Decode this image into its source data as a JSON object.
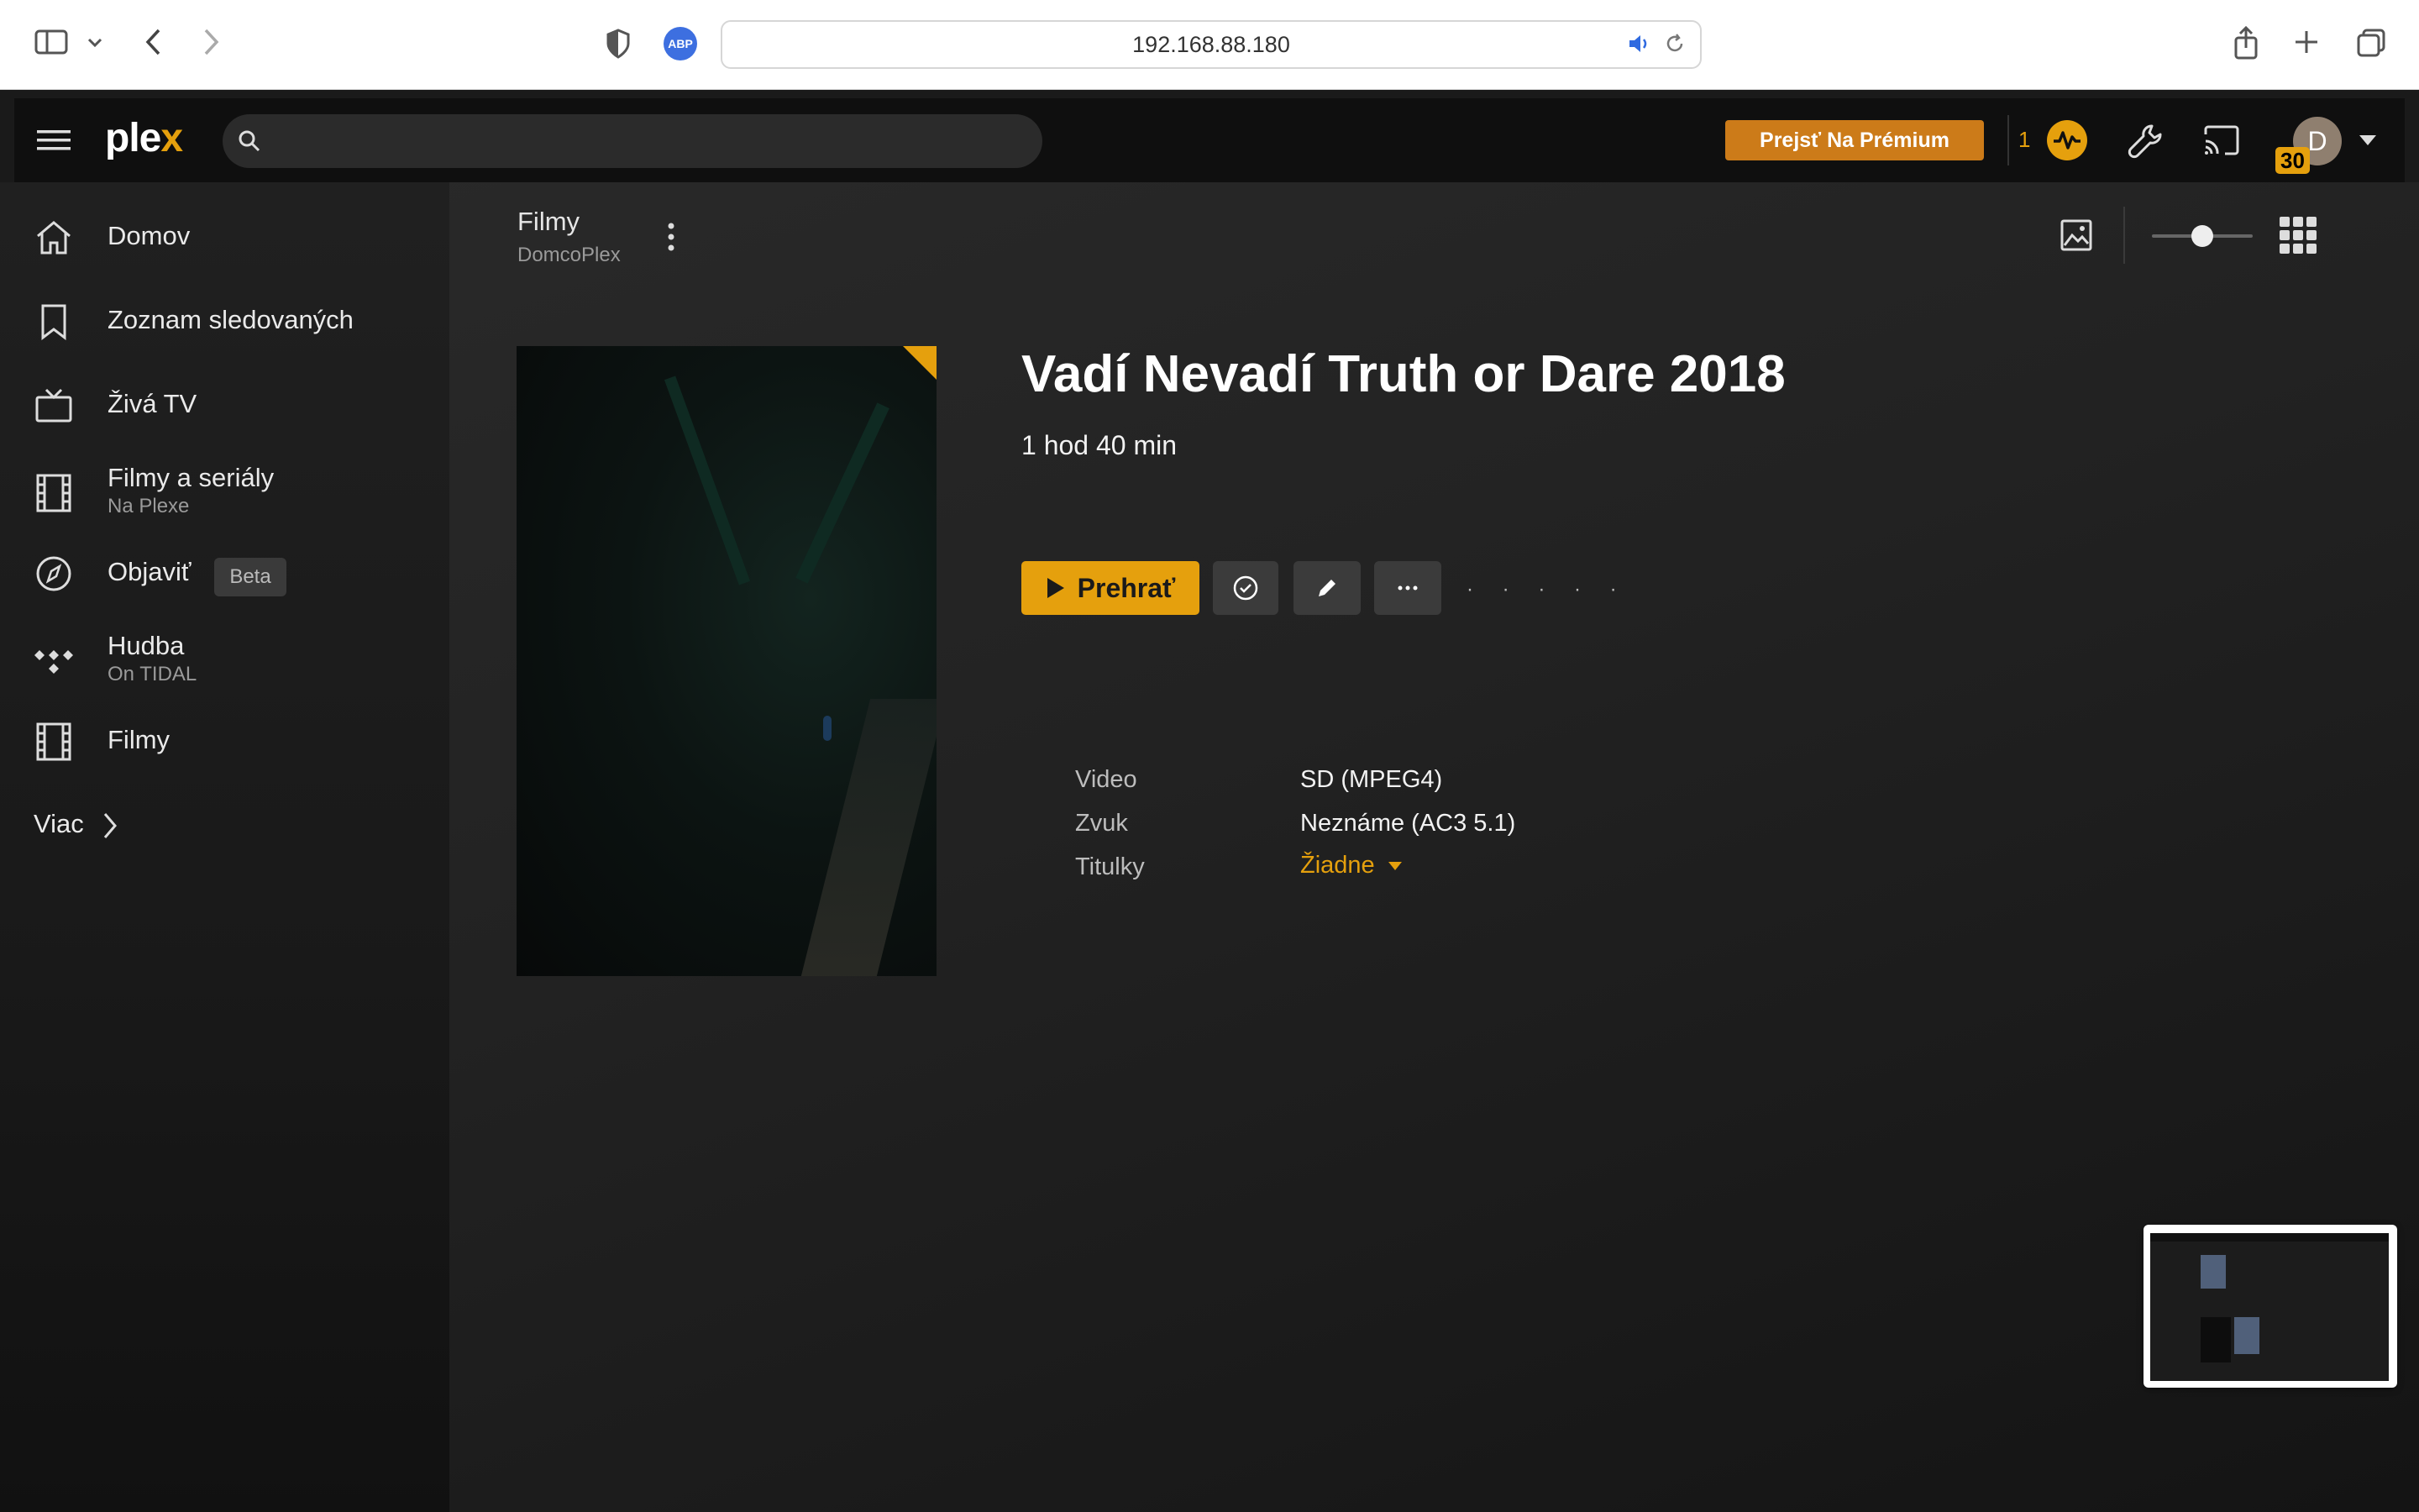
{
  "browser": {
    "url": "192.168.88.180",
    "abp_label": "ABP"
  },
  "header": {
    "logo_text": "plex",
    "logo_accent": "x",
    "search_placeholder": "",
    "premium_label": "Prejsť Na Prémium",
    "activity_count": "1",
    "avatar_initial": "D",
    "avatar_badge": "30"
  },
  "sidebar": {
    "items": [
      {
        "label": "Domov",
        "icon": "home-icon"
      },
      {
        "label": "Zoznam sledovaných",
        "icon": "bookmark-icon"
      },
      {
        "label": "Živá TV",
        "icon": "tv-icon"
      },
      {
        "label": "Filmy a seriály",
        "sub": "Na Plexe",
        "icon": "film-icon"
      },
      {
        "label": "Objaviť",
        "badge": "Beta",
        "icon": "compass-icon"
      },
      {
        "label": "Hudba",
        "sub": "On TIDAL",
        "icon": "tidal-icon"
      },
      {
        "label": "Filmy",
        "icon": "film-icon"
      }
    ],
    "more_label": "Viac"
  },
  "library": {
    "title": "Filmy",
    "server": "DomcoPlex"
  },
  "movie": {
    "title": "Vadí Nevadí Truth or Dare 2018",
    "duration": "1 hod 40 min",
    "play_label": "Prehrať",
    "dots": "· · · · ·",
    "meta": [
      {
        "label": "Video",
        "value": "SD (MPEG4)"
      },
      {
        "label": "Zvuk",
        "value": "Neznáme (AC3 5.1)"
      },
      {
        "label": "Titulky",
        "value": "Žiadne"
      }
    ]
  },
  "colors": {
    "accent": "#e5a00d",
    "premium": "#cc7b19",
    "top_bar": "#0f0f0f",
    "background": "#1f1f1f"
  }
}
